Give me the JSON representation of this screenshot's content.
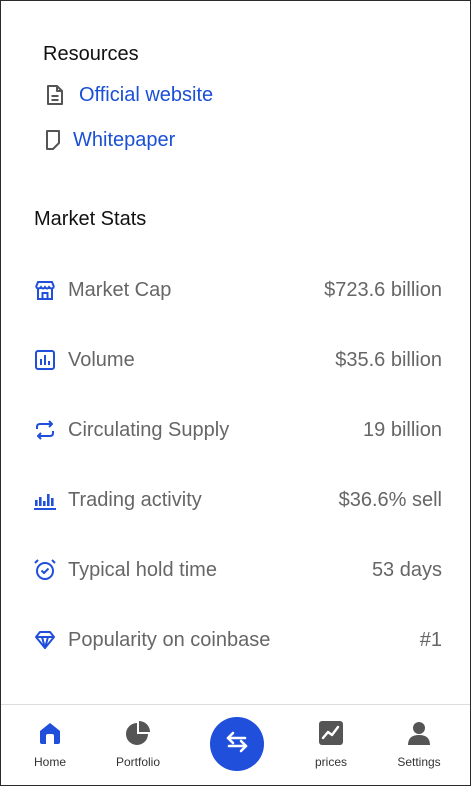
{
  "resources": {
    "title": "Resources",
    "items": [
      {
        "label": "Official website",
        "icon": "document-icon"
      },
      {
        "label": "Whitepaper",
        "icon": "page-icon"
      }
    ]
  },
  "market_stats": {
    "title": "Market Stats",
    "rows": [
      {
        "icon": "store-icon",
        "label": "Market Cap",
        "value": "$723.6 billion"
      },
      {
        "icon": "bar-chart-icon",
        "label": "Volume",
        "value": "$35.6 billion"
      },
      {
        "icon": "cycle-arrows-icon",
        "label": "Circulating Supply",
        "value": "19 billion"
      },
      {
        "icon": "activity-bars-icon",
        "label": "Trading activity",
        "value": "$36.6% sell"
      },
      {
        "icon": "alarm-clock-icon",
        "label": "Typical hold time",
        "value": "53 days"
      },
      {
        "icon": "diamond-icon",
        "label": "Popularity on coinbase",
        "value": "#1"
      }
    ]
  },
  "nav": {
    "home": "Home",
    "portfolio": "Portfolio",
    "prices": "prices",
    "settings": "Settings"
  },
  "colors": {
    "accent": "#1f4fdb",
    "link": "#1a4fd6",
    "muted_text": "#666666",
    "nav_icon": "#555555"
  }
}
